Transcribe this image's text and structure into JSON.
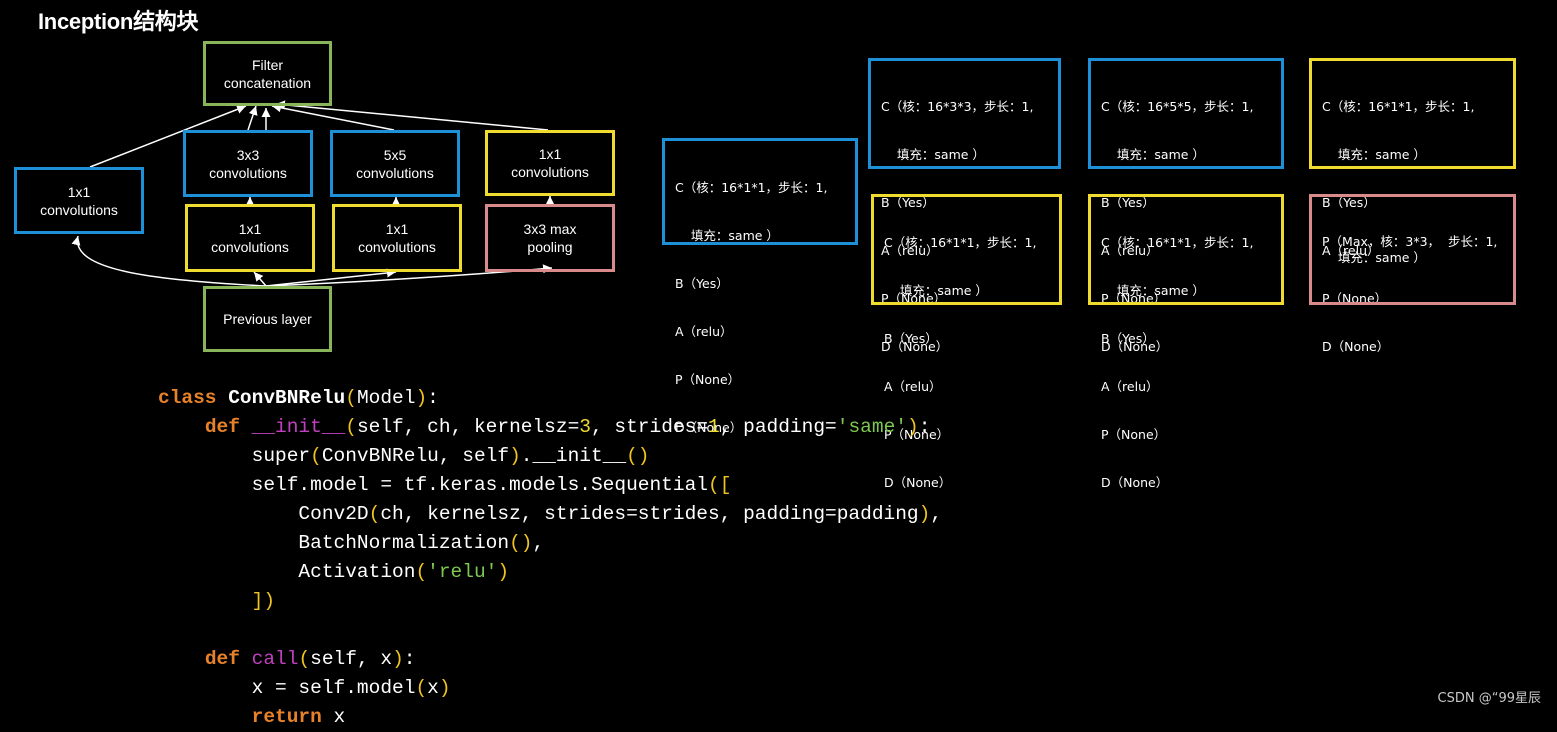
{
  "title": "Inception结构块",
  "diagram": {
    "nodes": {
      "filter_concat": [
        "Filter",
        "concatenation"
      ],
      "conv1x1_left": [
        "1x1",
        "convolutions"
      ],
      "conv3x3": [
        "3x3",
        "convolutions"
      ],
      "conv5x5": [
        "5x5",
        "convolutions"
      ],
      "conv1x1_right": [
        "1x1",
        "convolutions"
      ],
      "conv1x1_before3x3": [
        "1x1",
        "convolutions"
      ],
      "conv1x1_before5x5": [
        "1x1",
        "convolutions"
      ],
      "maxpool": [
        "3x3 max",
        "pooling"
      ],
      "previous_layer": [
        "Previous layer"
      ]
    },
    "colors": {
      "blue": "#1e90d8",
      "yellow": "#f0dc2e",
      "green": "#88b45a",
      "pink": "#d98a8a"
    }
  },
  "param_boxes": {
    "b1": [
      "C（核：16*1*1，步长：1,",
      "    填充：same ）",
      "B（Yes）",
      "A（relu）",
      "P（None）",
      "D（None）"
    ],
    "b2_top": [
      "C（核：16*3*3，步长：1,",
      "    填充：same ）",
      "B（Yes）",
      "A（relu）",
      "P（None）",
      "D（None）"
    ],
    "b2_bottom": [
      "C（核：16*1*1，步长：1,",
      "    填充：same ）",
      "B（Yes）",
      "A（relu）",
      "P（None）",
      "D（None）"
    ],
    "b3_top": [
      "C（核：16*5*5，步长：1,",
      "    填充：same ）",
      "B（Yes）",
      "A（relu）",
      "P（None）",
      "D（None）"
    ],
    "b3_bottom": [
      "C（核：16*1*1，步长：1,",
      "    填充：same ）",
      "B（Yes）",
      "A（relu）",
      "P（None）",
      "D（None）"
    ],
    "b4_top": [
      "C（核：16*1*1，步长：1,",
      "    填充：same ）",
      "B（Yes）",
      "A（relu）",
      "P（None）",
      "D（None）"
    ],
    "b4_bottom": [
      "P（Max，核：3*3，  步长：1,",
      "    填充：same ）"
    ]
  },
  "code_lines": [
    [
      [
        "class ",
        "kw"
      ],
      [
        "ConvBNRelu",
        "cls"
      ],
      [
        "(",
        "pn"
      ],
      [
        "Model",
        ""
      ],
      [
        ")",
        "pn"
      ],
      [
        ":",
        ""
      ]
    ],
    [
      [
        "    ",
        ""
      ],
      [
        "def ",
        "kw"
      ],
      [
        "__init__",
        "fn"
      ],
      [
        "(",
        "pn"
      ],
      [
        "self, ch, kernelsz=",
        ""
      ],
      [
        "3",
        "num"
      ],
      [
        ", strides=",
        ""
      ],
      [
        "1",
        "num"
      ],
      [
        ", padding=",
        ""
      ],
      [
        "'same'",
        "str"
      ],
      [
        ")",
        "pn"
      ],
      [
        ":",
        ""
      ]
    ],
    [
      [
        "        super",
        ""
      ],
      [
        "(",
        "pn"
      ],
      [
        "ConvBNRelu, self",
        ""
      ],
      [
        ")",
        "pn"
      ],
      [
        ".__init__",
        ""
      ],
      [
        "()",
        "pn"
      ]
    ],
    [
      [
        "        self.model = tf.keras.models.Sequential",
        ""
      ],
      [
        "([",
        "pn"
      ]
    ],
    [
      [
        "            Conv2D",
        ""
      ],
      [
        "(",
        "pn"
      ],
      [
        "ch, kernelsz, strides=strides, padding=padding",
        ""
      ],
      [
        ")",
        "pn"
      ],
      [
        ",",
        ""
      ]
    ],
    [
      [
        "            BatchNormalization",
        ""
      ],
      [
        "()",
        "pn"
      ],
      [
        ",",
        ""
      ]
    ],
    [
      [
        "            Activation",
        ""
      ],
      [
        "(",
        "pn"
      ],
      [
        "'relu'",
        "str"
      ],
      [
        ")",
        "pn"
      ]
    ],
    [
      [
        "        ",
        ""
      ],
      [
        "])",
        "pn"
      ]
    ],
    [
      [
        "",
        ""
      ]
    ],
    [
      [
        "    ",
        ""
      ],
      [
        "def ",
        "kw"
      ],
      [
        "call",
        "fn"
      ],
      [
        "(",
        "pn"
      ],
      [
        "self, x",
        ""
      ],
      [
        ")",
        "pn"
      ],
      [
        ":",
        ""
      ]
    ],
    [
      [
        "        x = self.model",
        ""
      ],
      [
        "(",
        "pn"
      ],
      [
        "x",
        ""
      ],
      [
        ")",
        "pn"
      ]
    ],
    [
      [
        "        ",
        ""
      ],
      [
        "return ",
        "kw"
      ],
      [
        "x",
        ""
      ]
    ]
  ],
  "watermark": "CSDN @“99星辰"
}
